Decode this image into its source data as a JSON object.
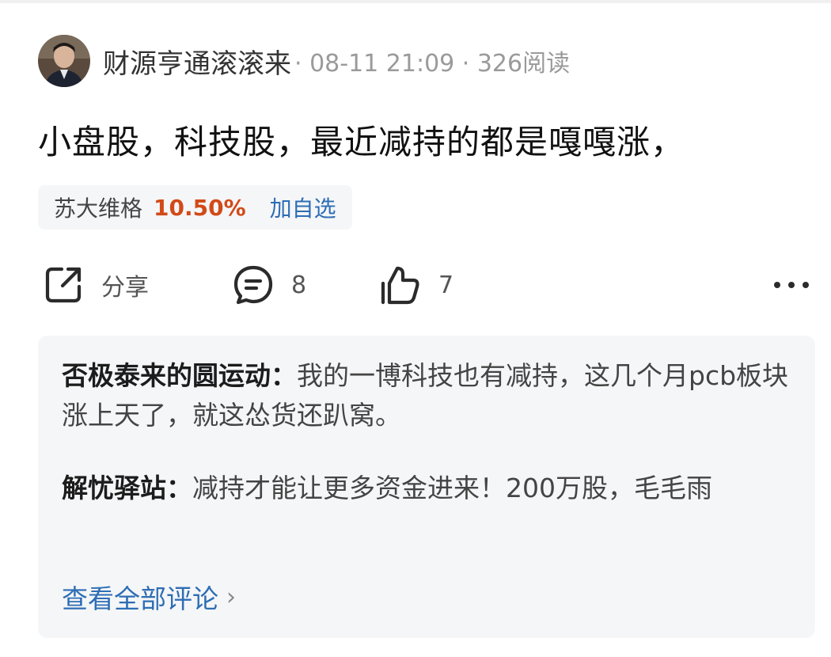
{
  "post": {
    "author": "财源亨通滚滚来",
    "meta": "· 08-11 21:09 · 326阅读",
    "content": "小盘股，科技股，最近减持的都是嘎嘎涨，"
  },
  "stock": {
    "name": "苏大维格",
    "change": "10.50%",
    "add_label": "加自选"
  },
  "actions": {
    "share_label": "分享",
    "comment_count": "8",
    "like_count": "7"
  },
  "comments": [
    {
      "user": "否极泰来的圆运动",
      "sep": "：",
      "text": "我的一博科技也有减持，这几个月pcb板块涨上天了，就这怂货还趴窝。"
    },
    {
      "user": "解忧驿站",
      "sep": "：",
      "text": "减持才能让更多资金进来！200万股，毛毛雨"
    }
  ],
  "view_all_label": "查看全部评论",
  "colors": {
    "accent_red": "#d24a17",
    "link_blue": "#2e6db4"
  },
  "icons": [
    "avatar",
    "share-icon",
    "comment-icon",
    "like-icon",
    "more-icon",
    "chevron-right-icon"
  ]
}
